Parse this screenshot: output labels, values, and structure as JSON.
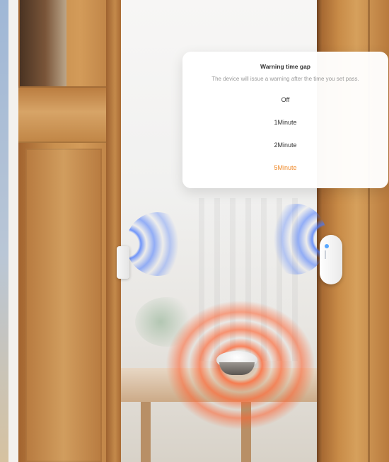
{
  "dialog": {
    "title": "Warning time gap",
    "subtitle": "The device will issue a warning after the time you set pass.",
    "options": [
      "Off",
      "1Minute",
      "2Minute",
      "5Minute"
    ],
    "selected_option": "5Minute",
    "accent_color": "#f08a2a"
  },
  "scene": {
    "icons": [
      "door-sensor-left-icon",
      "door-sensor-right-icon",
      "hub-icon"
    ]
  }
}
